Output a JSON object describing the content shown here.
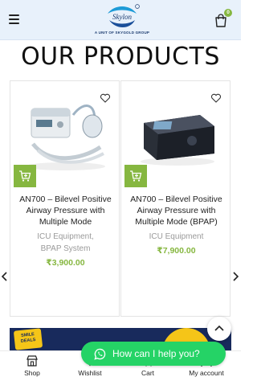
{
  "header": {
    "logo_text": "Skylon",
    "logo_tagline": "A UNIT OF SKYGOLD GROUP",
    "cart_count": "0",
    "colors": {
      "header_bg": "#e8f1fb",
      "badge": "#86b740"
    }
  },
  "page_title": "OUR PRODUCTS",
  "products": [
    {
      "title": "AN700 – Bilevel Positive Airway Pressure with Multiple Mode",
      "categories": [
        "ICU Equipment",
        "BPAP System"
      ],
      "price": "₹3,900.00"
    },
    {
      "title": "AN700 – Bilevel Positive Airway Pressure with Multiple Mode (BPAP)",
      "categories": [
        "ICU Equipment"
      ],
      "price": "₹7,900.00"
    }
  ],
  "banner": {
    "badge_text": "SMILE DEALS"
  },
  "chat": {
    "label": "How can I help you?"
  },
  "bottom_nav": {
    "items": [
      {
        "label": "Shop",
        "icon": "shop-icon"
      },
      {
        "label": "Wishlist",
        "icon": "heart-icon"
      },
      {
        "label": "Cart",
        "icon": "cart-icon"
      },
      {
        "label": "My account",
        "icon": "user-icon"
      }
    ]
  },
  "colors": {
    "accent": "#86b740",
    "whatsapp": "#25d366",
    "banner": "#182a5c"
  }
}
